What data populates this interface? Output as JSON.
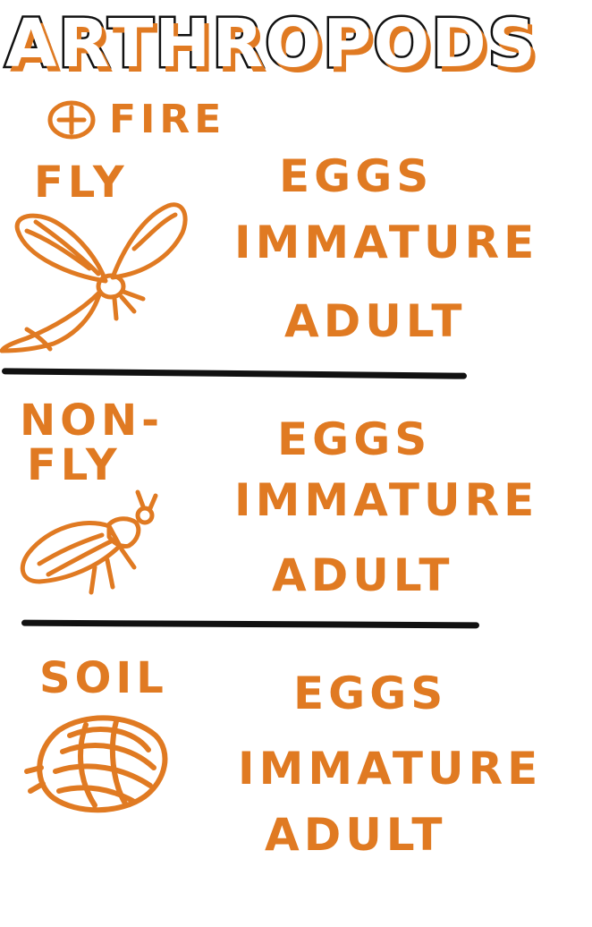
{
  "title": "ARTHROPODS",
  "subtitle": "FIRE",
  "colors": {
    "ink": "#e07a22",
    "outline": "#111111",
    "background": "#ffffff"
  },
  "groups": [
    {
      "label": "FLY",
      "icon": "fly-icon",
      "stages": [
        "EGGS",
        "IMMATURE",
        "ADULT"
      ]
    },
    {
      "label_lines": [
        "NON-",
        "FLY"
      ],
      "icon": "beetle-icon",
      "stages": [
        "EGGS",
        "IMMATURE",
        "ADULT"
      ]
    },
    {
      "label": "SOIL",
      "icon": "soil-grub-icon",
      "stages": [
        "EGGS",
        "IMMATURE",
        "ADULT"
      ]
    }
  ]
}
